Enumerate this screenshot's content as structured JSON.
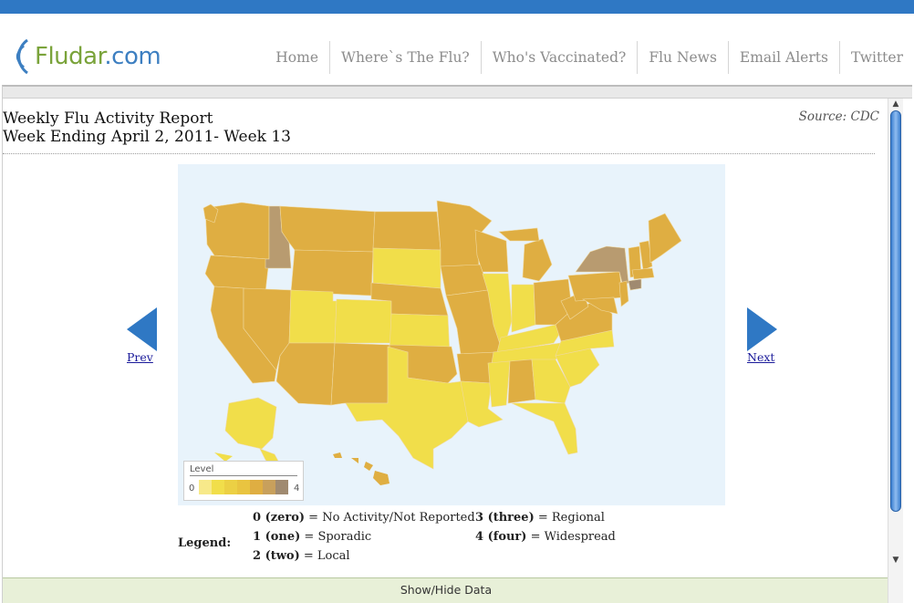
{
  "logo": {
    "name": "Fludar",
    "suffix": ".com"
  },
  "nav": {
    "items": [
      "Home",
      "Where`s The Flu?",
      "Who's Vaccinated?",
      "Flu News",
      "Email Alerts",
      "Twitter"
    ]
  },
  "report": {
    "title_line1": "Weekly Flu Activity Report",
    "title_line2": "Week Ending April 2, 2011- Week 13",
    "source": "Source: CDC"
  },
  "pager": {
    "prev": "Prev",
    "next": "Next"
  },
  "map_legend": {
    "title": "Level",
    "min": "0",
    "max": "4"
  },
  "legend": {
    "label": "Legend:",
    "entries": [
      {
        "code": "0 (zero)",
        "desc": " = No Activity/Not Reported"
      },
      {
        "code": "1 (one)",
        "desc": " = Sporadic"
      },
      {
        "code": "2 (two)",
        "desc": " = Local"
      },
      {
        "code": "3 (three)",
        "desc": " = Regional"
      },
      {
        "code": "4 (four)",
        "desc": " = Widespread"
      }
    ]
  },
  "show_hide": "Show/Hide Data",
  "colors": {
    "header_bar": "#2f78c4",
    "level_scale": [
      "#f7e98a",
      "#f1de4a",
      "#ecd044",
      "#e9c440",
      "#dfae42",
      "#c8a05c",
      "#a08a70"
    ],
    "map_background": "#e8f3fb"
  }
}
